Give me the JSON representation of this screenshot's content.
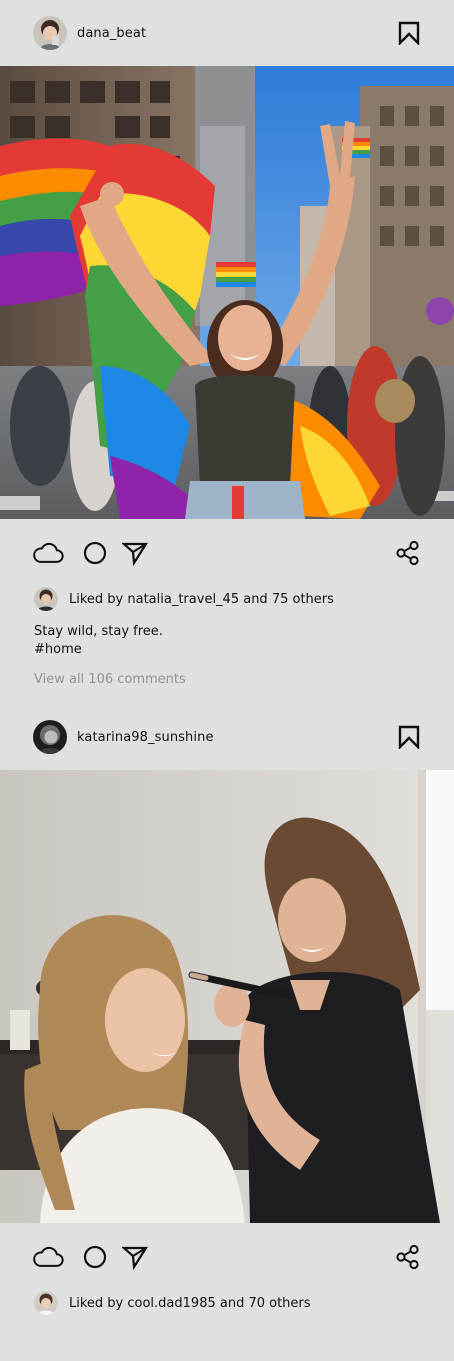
{
  "posts": [
    {
      "username": "dana_beat",
      "liked_by_text": "Liked by natalia_travel_45 and 75 others",
      "caption_line1": "Stay wild, stay free.",
      "caption_line2": "#home",
      "view_comments": "View all 106 comments"
    },
    {
      "username": "katarina98_sunshine",
      "liked_by_text": "Liked by cool.dad1985 and 70 others"
    }
  ],
  "icons": {
    "bookmark": "bookmark-icon",
    "like": "cloud-icon",
    "comment": "circle-icon",
    "share_send": "send-icon",
    "share": "share-icon"
  },
  "colors": {
    "background": "#dfe1e1",
    "text": "#111111",
    "muted": "#8f9393"
  }
}
